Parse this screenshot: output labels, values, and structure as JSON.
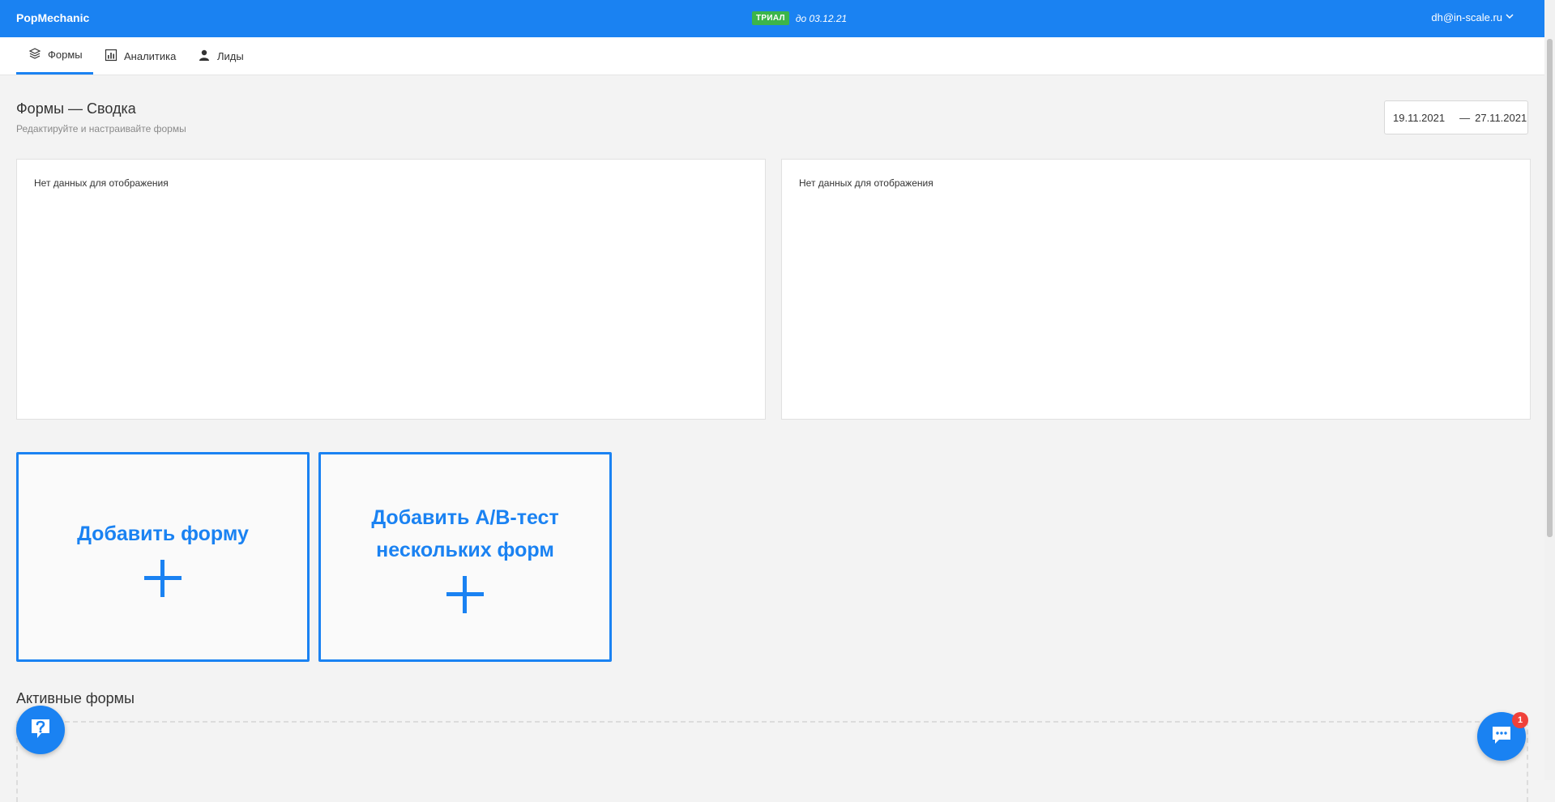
{
  "header": {
    "brand": "PopMechanic",
    "trial_badge": "ТРИАЛ",
    "trial_until": "до 03.12.21",
    "user_email": "dh@in-scale.ru"
  },
  "nav": {
    "tabs": [
      {
        "label": "Формы",
        "icon": "layers-icon",
        "active": true
      },
      {
        "label": "Аналитика",
        "icon": "bar-chart-icon",
        "active": false
      },
      {
        "label": "Лиды",
        "icon": "user-icon",
        "active": false
      }
    ]
  },
  "page": {
    "title": "Формы — Сводка",
    "subtitle": "Редактируйте и настраивайте формы"
  },
  "date_range": {
    "from": "19.11.2021",
    "separator": "—",
    "to": "27.11.2021"
  },
  "panels": [
    {
      "empty_text": "Нет данных для отображения"
    },
    {
      "empty_text": "Нет данных для отображения"
    }
  ],
  "actions": {
    "add_form": "Добавить форму",
    "add_ab_test": "Добавить A/B-тест нескольких форм"
  },
  "active_forms": {
    "title": "Активные формы"
  },
  "chat": {
    "badge_count": "1"
  },
  "colors": {
    "accent": "#1a82f2",
    "trial_badge": "#3cb54a",
    "notification": "#f0413a"
  }
}
